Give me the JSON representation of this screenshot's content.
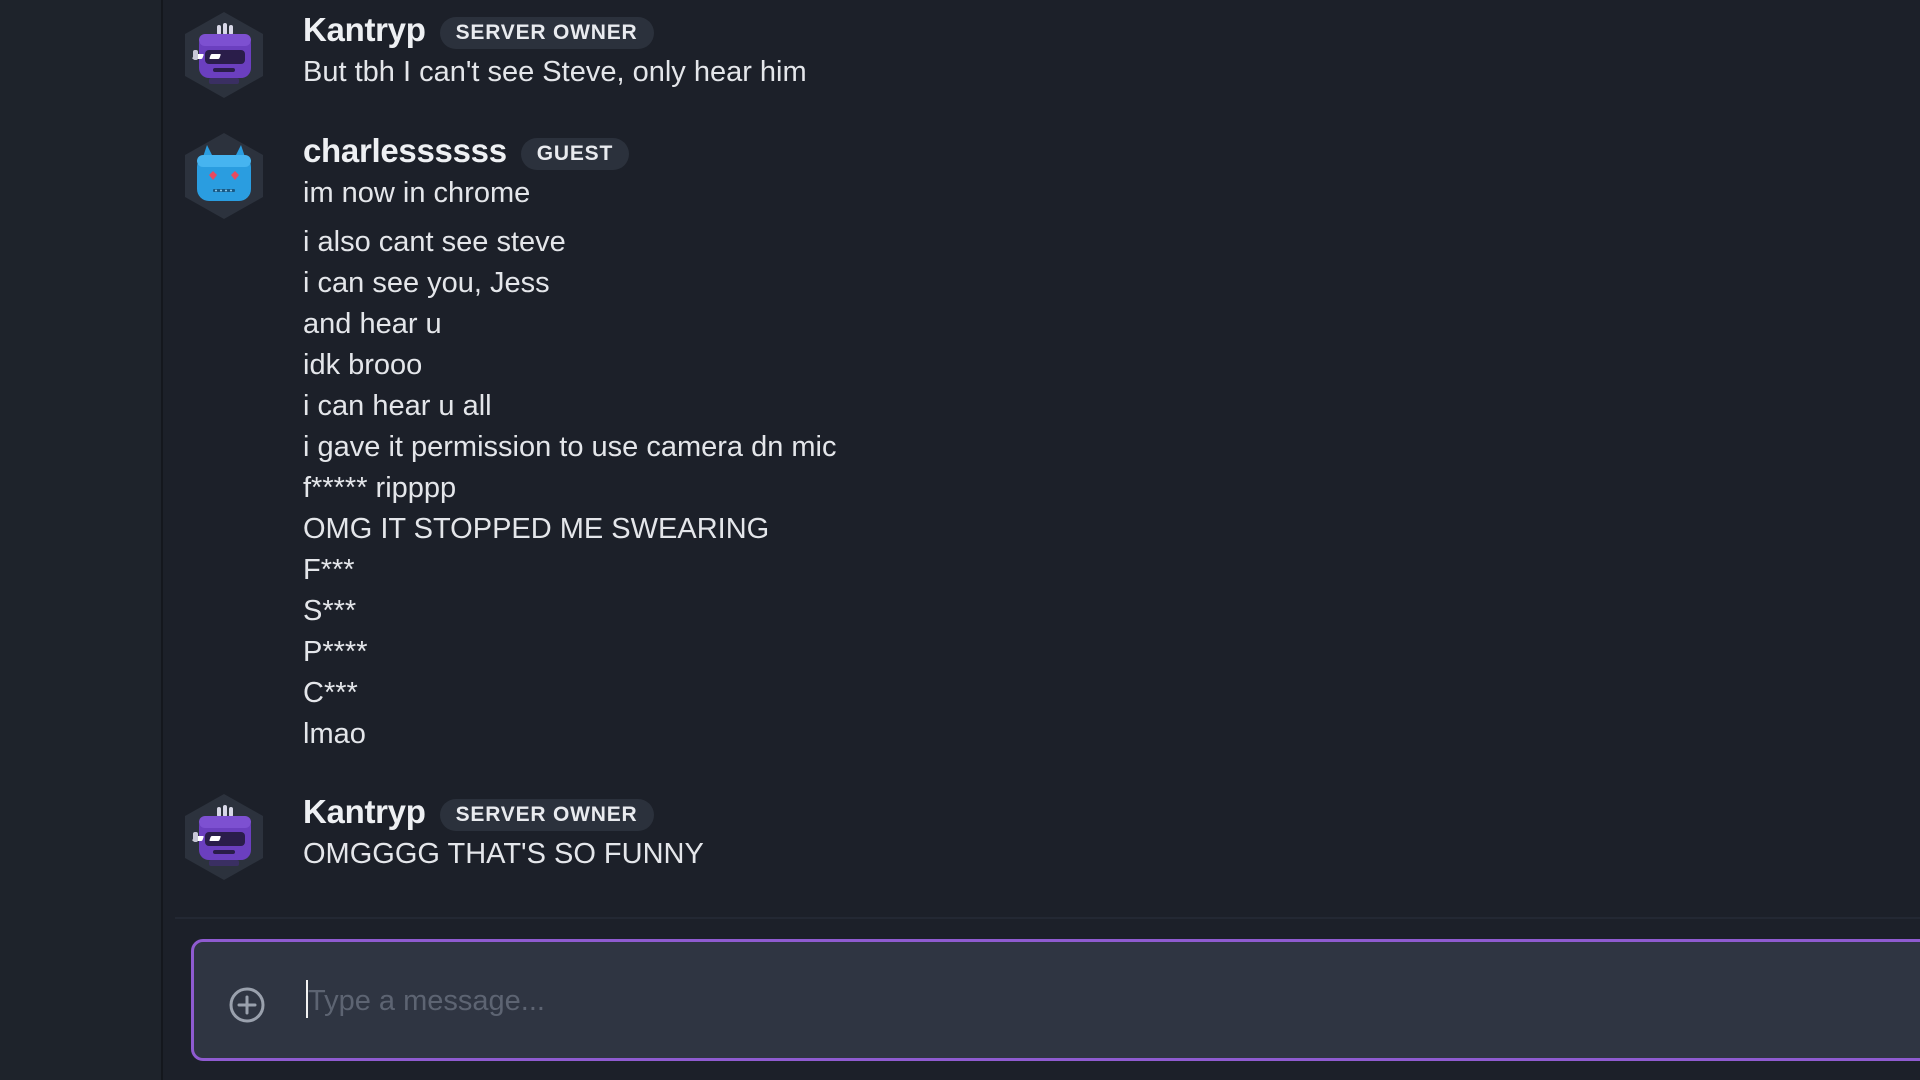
{
  "messages": [
    {
      "author": "Kantryp",
      "role": "SERVER OWNER",
      "avatar": "purple-robot-icon",
      "lines": [
        "But tbh I can't see Steve, only hear him"
      ]
    },
    {
      "author": "charlessssss",
      "role": "GUEST",
      "avatar": "blue-robot-icon",
      "lines": [
        "im now in chrome",
        "i also cant see steve",
        "i can see you, Jess",
        "and hear u",
        "idk brooo",
        "i can hear u all",
        "i gave it permission to use camera dn mic",
        "f***** ripppp",
        "OMG IT STOPPED ME SWEARING",
        "F***",
        "S***",
        "P****",
        "C***",
        "lmao"
      ]
    },
    {
      "author": "Kantryp",
      "role": "SERVER OWNER",
      "avatar": "purple-robot-icon",
      "lines": [
        "OMGGGG THAT'S SO FUNNY"
      ]
    }
  ],
  "composer": {
    "placeholder": "Type a message...",
    "value": "",
    "add_icon": "plus-circle-icon"
  },
  "colors": {
    "background": "#1c2029",
    "composer_border": "#8f5bd0",
    "purple_avatar": "#6b3fbf",
    "blue_avatar": "#2a9de0"
  }
}
